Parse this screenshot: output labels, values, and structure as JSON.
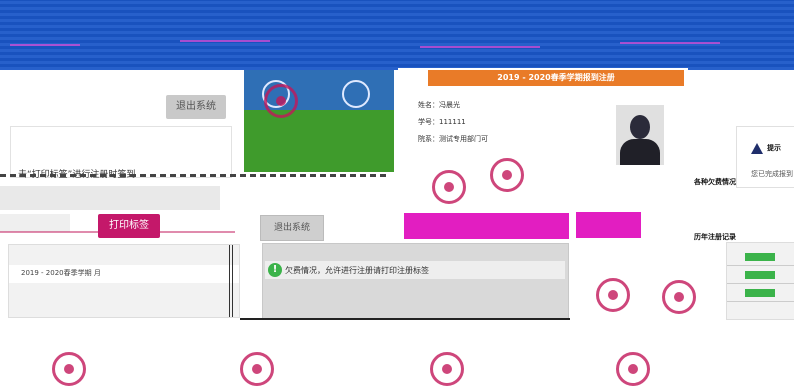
{
  "left_panel": {
    "logout_label": "退出系统",
    "instruction": "击“打印标签”进行注册时签到",
    "print_button": "打印标签",
    "logout_label_2": "退出系统",
    "semester_row": "2019 - 2020春季学期 月"
  },
  "status": {
    "icon": "check-icon",
    "message": "欠费情况，允许进行注册请打印注册标签"
  },
  "registration": {
    "header": "2019 - 2020春季学期报到注册",
    "name_label": "姓名：",
    "name_value": "冯晨光",
    "id_label": "学号：",
    "id_value": "111111",
    "dept_label": "院系：",
    "dept_value": "测试专用部门可"
  },
  "hint": {
    "title": "提示",
    "text": "您已完成报到"
  },
  "fees_title": "各种欠费情况",
  "history_title": "历年注册记录",
  "colors": {
    "banner": "#1a56c8",
    "header_orange": "#e97b28",
    "print_button": "#c4186a",
    "magenta": "#e21ec1",
    "status_green": "#3bb34a"
  }
}
